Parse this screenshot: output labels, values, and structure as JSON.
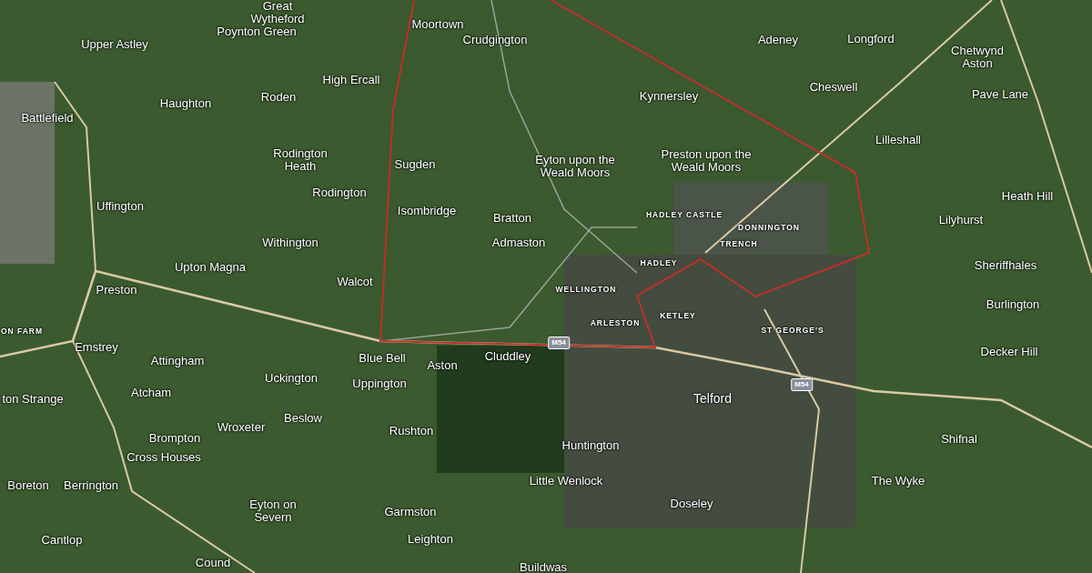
{
  "map": {
    "place_labels": [
      {
        "text": "Great Wytheford",
        "kind": "village"
      },
      {
        "text": "Upper Astley",
        "kind": "village"
      },
      {
        "text": "Poynton Green",
        "kind": "village"
      },
      {
        "text": "Moortown",
        "kind": "village"
      },
      {
        "text": "Crudgington",
        "kind": "village"
      },
      {
        "text": "Adeney",
        "kind": "village"
      },
      {
        "text": "Longford",
        "kind": "village"
      },
      {
        "text": "Chetwynd Aston",
        "kind": "village"
      },
      {
        "text": "Battlefield",
        "kind": "village"
      },
      {
        "text": "Haughton",
        "kind": "village"
      },
      {
        "text": "Roden",
        "kind": "village"
      },
      {
        "text": "High Ercall",
        "kind": "village"
      },
      {
        "text": "Kynnersley",
        "kind": "village"
      },
      {
        "text": "Cheswell",
        "kind": "village"
      },
      {
        "text": "Pave Lane",
        "kind": "village"
      },
      {
        "text": "Rodington Heath",
        "kind": "village"
      },
      {
        "text": "Sugden",
        "kind": "village"
      },
      {
        "text": "Eyton upon the Weald Moors",
        "kind": "village"
      },
      {
        "text": "Preston upon the Weald Moors",
        "kind": "village"
      },
      {
        "text": "Lilleshall",
        "kind": "village"
      },
      {
        "text": "Uffington",
        "kind": "village"
      },
      {
        "text": "Rodington",
        "kind": "village"
      },
      {
        "text": "Isombridge",
        "kind": "village"
      },
      {
        "text": "Bratton",
        "kind": "village"
      },
      {
        "text": "HADLEY CASTLE",
        "kind": "district"
      },
      {
        "text": "DONNINGTON",
        "kind": "district"
      },
      {
        "text": "Lilyhurst",
        "kind": "village"
      },
      {
        "text": "Heath Hill",
        "kind": "village"
      },
      {
        "text": "Withington",
        "kind": "village"
      },
      {
        "text": "Admaston",
        "kind": "village"
      },
      {
        "text": "TRENCH",
        "kind": "district"
      },
      {
        "text": "Upton Magna",
        "kind": "village"
      },
      {
        "text": "HADLEY",
        "kind": "district"
      },
      {
        "text": "Sheriffhales",
        "kind": "village"
      },
      {
        "text": "Preston",
        "kind": "village"
      },
      {
        "text": "Walcot",
        "kind": "village"
      },
      {
        "text": "WELLINGTON",
        "kind": "district"
      },
      {
        "text": "Burlington",
        "kind": "village"
      },
      {
        "text": "ON FARM",
        "kind": "district"
      },
      {
        "text": "ARLESTON",
        "kind": "district"
      },
      {
        "text": "KETLEY",
        "kind": "district"
      },
      {
        "text": "ST GEORGE'S",
        "kind": "district"
      },
      {
        "text": "Emstrey",
        "kind": "village"
      },
      {
        "text": "Attingham",
        "kind": "village"
      },
      {
        "text": "Blue Bell",
        "kind": "village"
      },
      {
        "text": "Aston",
        "kind": "village"
      },
      {
        "text": "Cluddley",
        "kind": "village"
      },
      {
        "text": "Decker Hill",
        "kind": "village"
      },
      {
        "text": "ton Strange",
        "kind": "village"
      },
      {
        "text": "Atcham",
        "kind": "village"
      },
      {
        "text": "Uckington",
        "kind": "village"
      },
      {
        "text": "Uppington",
        "kind": "village"
      },
      {
        "text": "Telford",
        "kind": "town"
      },
      {
        "text": "Wroxeter",
        "kind": "village"
      },
      {
        "text": "Beslow",
        "kind": "village"
      },
      {
        "text": "Rushton",
        "kind": "village"
      },
      {
        "text": "Brompton",
        "kind": "village"
      },
      {
        "text": "Huntington",
        "kind": "village"
      },
      {
        "text": "Shifnal",
        "kind": "village"
      },
      {
        "text": "Cross Houses",
        "kind": "village"
      },
      {
        "text": "Boreton",
        "kind": "village"
      },
      {
        "text": "Berrington",
        "kind": "village"
      },
      {
        "text": "Little Wenlock",
        "kind": "village"
      },
      {
        "text": "The Wyke",
        "kind": "village"
      },
      {
        "text": "Eyton on Severn",
        "kind": "village"
      },
      {
        "text": "Garmston",
        "kind": "village"
      },
      {
        "text": "Doseley",
        "kind": "village"
      },
      {
        "text": "Cantlop",
        "kind": "village"
      },
      {
        "text": "Leighton",
        "kind": "village"
      },
      {
        "text": "Cound",
        "kind": "village"
      },
      {
        "text": "Buildwas",
        "kind": "village"
      }
    ],
    "road_shields": [
      {
        "text": "M54"
      },
      {
        "text": "M54"
      }
    ]
  }
}
